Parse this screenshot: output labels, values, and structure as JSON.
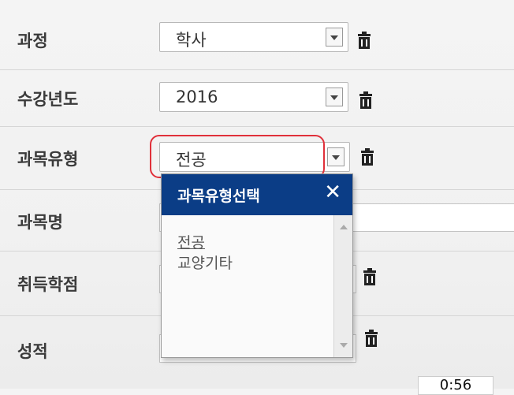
{
  "form": {
    "rows": [
      {
        "label": "과정",
        "value": "학사"
      },
      {
        "label": "수강년도",
        "value": "2016"
      },
      {
        "label": "과목유형",
        "value": "전공"
      },
      {
        "label": "과목명"
      },
      {
        "label": "취득학점"
      },
      {
        "label": "성적"
      }
    ]
  },
  "popup": {
    "title": "과목유형선택",
    "close_glyph": "✕",
    "items": [
      "전공",
      "교양기타"
    ]
  },
  "overlay": {
    "time": "0:56"
  },
  "colors": {
    "popup_header": "#0b3d86",
    "annotation_circle": "#e0303a"
  },
  "icons": [
    "chevron-down-icon",
    "trash-icon",
    "close-icon"
  ]
}
